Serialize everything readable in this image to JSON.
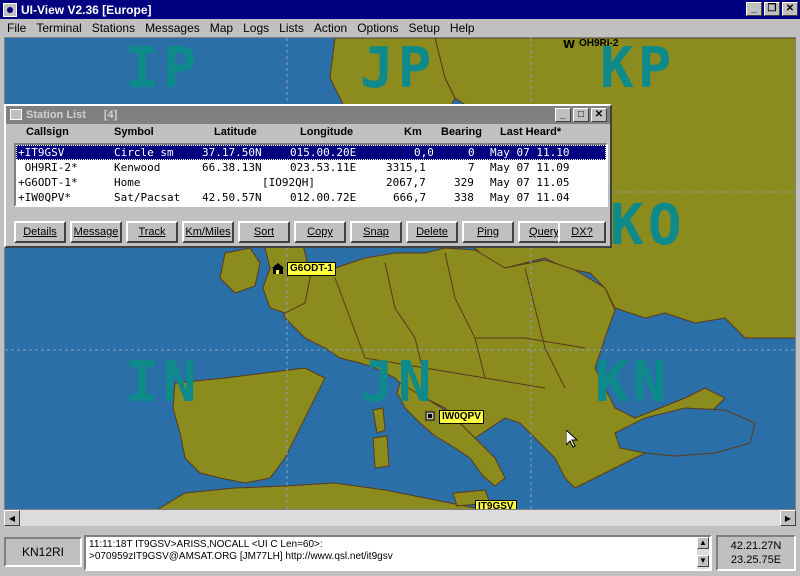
{
  "window": {
    "title": "UI-View V2.36 [Europe]"
  },
  "menu": [
    "File",
    "Terminal",
    "Stations",
    "Messages",
    "Map",
    "Logs",
    "Lists",
    "Action",
    "Options",
    "Setup",
    "Help"
  ],
  "map": {
    "grid_labels": [
      "IP",
      "JP",
      "KP",
      "KO",
      "IN",
      "JN",
      "KN"
    ],
    "stations": [
      {
        "id": "OH9RI-2"
      },
      {
        "id": "G6ODT-1"
      },
      {
        "id": "IW0QPV"
      },
      {
        "id": "IT9GSV"
      }
    ]
  },
  "station_list": {
    "title": "Station List",
    "count": "[4]",
    "columns": [
      "Callsign",
      "Symbol",
      "Latitude",
      "Longitude",
      "Km",
      "Bearing",
      "Last Heard*"
    ],
    "rows": [
      {
        "callsign": "+IT9GSV",
        "symbol": "Circle sm",
        "lat": "37.17.50N",
        "lon": "015.00.20E",
        "km": "0,0",
        "bearing": "0",
        "heard": "May 07 11.10",
        "selected": true
      },
      {
        "callsign": " OH9RI-2*",
        "symbol": "Kenwood",
        "lat": "66.38.13N",
        "lon": "023.53.11E",
        "km": "3315,1",
        "bearing": "7",
        "heard": "May 07 11.09",
        "selected": false
      },
      {
        "callsign": "+G6ODT-1*",
        "symbol": "Home",
        "lat": "[IO92QH]",
        "lon": "",
        "km": "2067,7",
        "bearing": "329",
        "heard": "May 07 11.05",
        "selected": false
      },
      {
        "callsign": "+IW0QPV*",
        "symbol": "Sat/Pacsat",
        "lat": "42.50.57N",
        "lon": "012.00.72E",
        "km": "666,7",
        "bearing": "338",
        "heard": "May 07 11.04",
        "selected": false
      }
    ],
    "buttons": [
      "Details",
      "Message",
      "Track",
      "Km/Miles",
      "Sort",
      "Copy",
      "Snap",
      "Delete",
      "Ping",
      "Query",
      "DX?"
    ]
  },
  "status": {
    "locator": "KN12RI",
    "message_line1": "11:11:18T IT9GSV>ARISS,NOCALL <UI C Len=60>:",
    "message_line2": ">070959zIT9GSV@AMSAT.ORG [JM77LH] http://www.qsl.net/it9gsv",
    "lat": "42.21.27N",
    "lon": "23.25.75E"
  },
  "colors": {
    "sea": "#2b6fa8",
    "land": "#8b8b1e",
    "title_active": "#000080",
    "grid_label": "#0f8a8a",
    "station_label": "#ffff40"
  }
}
